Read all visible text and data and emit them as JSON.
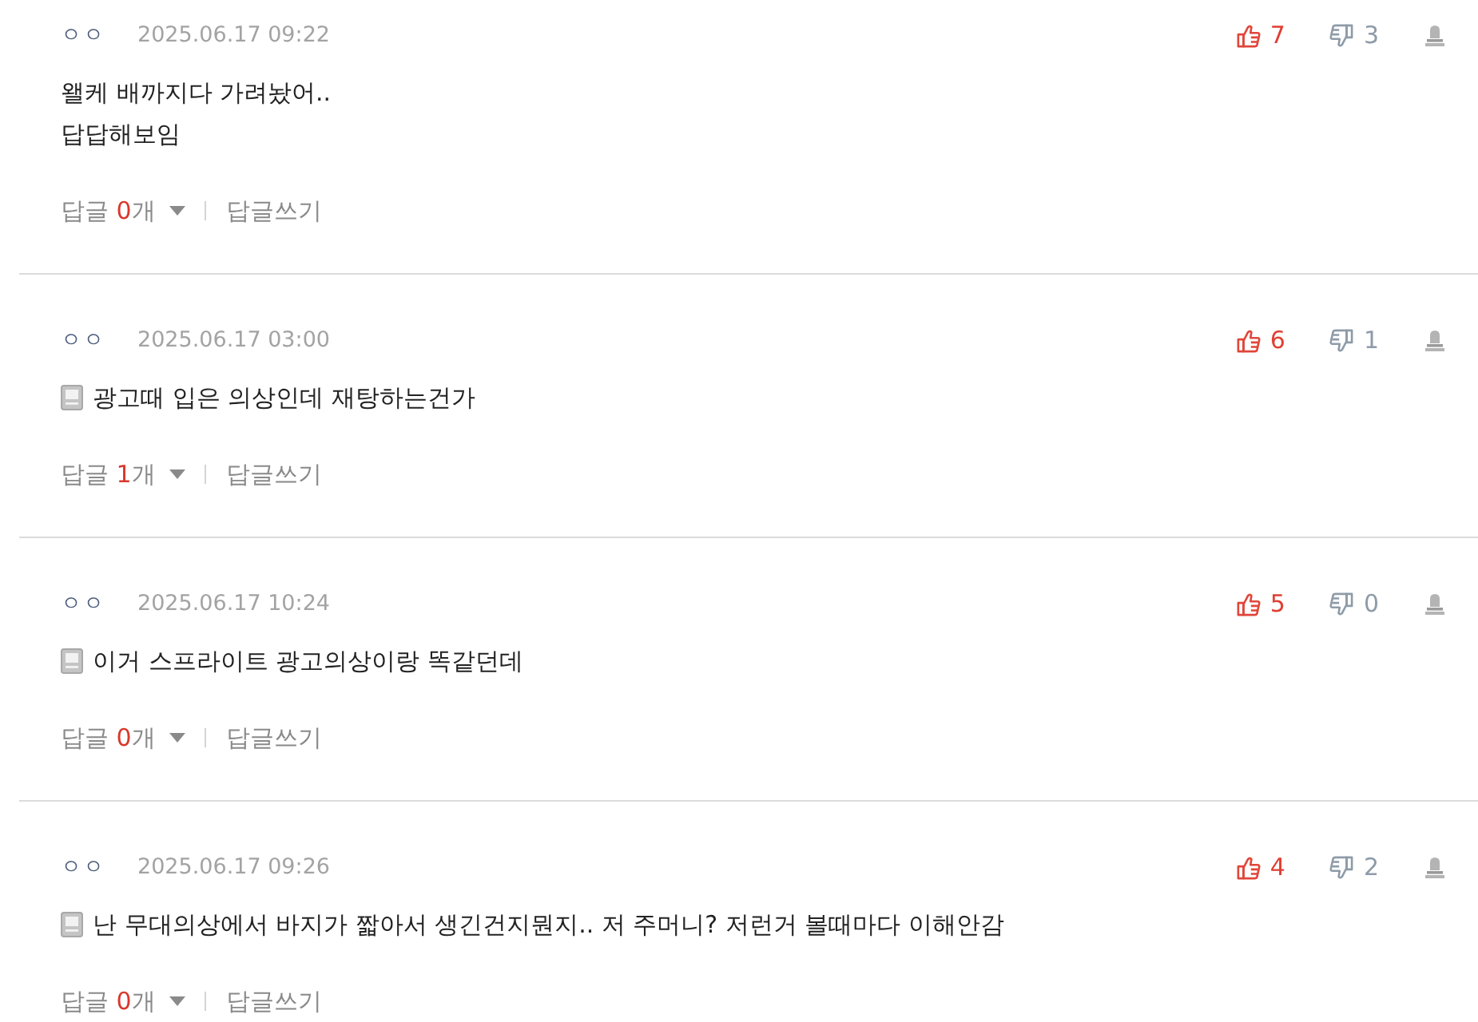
{
  "comments": [
    {
      "author": "ㅇㅇ",
      "date": "2025.06.17 09:22",
      "has_icon": false,
      "text": "왤케 배까지다 가려놨어..\n답답해보임",
      "likes": "7",
      "dislikes": "3",
      "replies_label": "답글",
      "reply_count": "0",
      "replies_unit": "개",
      "write_reply": "답글쓰기"
    },
    {
      "author": "ㅇㅇ",
      "date": "2025.06.17 03:00",
      "has_icon": true,
      "text": "광고때 입은 의상인데 재탕하는건가",
      "likes": "6",
      "dislikes": "1",
      "replies_label": "답글",
      "reply_count": "1",
      "replies_unit": "개",
      "write_reply": "답글쓰기"
    },
    {
      "author": "ㅇㅇ",
      "date": "2025.06.17 10:24",
      "has_icon": true,
      "text": "이거 스프라이트 광고의상이랑 똑같던데",
      "likes": "5",
      "dislikes": "0",
      "replies_label": "답글",
      "reply_count": "0",
      "replies_unit": "개",
      "write_reply": "답글쓰기"
    },
    {
      "author": "ㅇㅇ",
      "date": "2025.06.17 09:26",
      "has_icon": true,
      "text": "난 무대의상에서 바지가 짧아서 생긴건지뭔지.. 저 주머니? 저런거 볼때마다 이해안감",
      "likes": "4",
      "dislikes": "2",
      "replies_label": "답글",
      "reply_count": "0",
      "replies_unit": "개",
      "write_reply": "답글쓰기"
    }
  ]
}
